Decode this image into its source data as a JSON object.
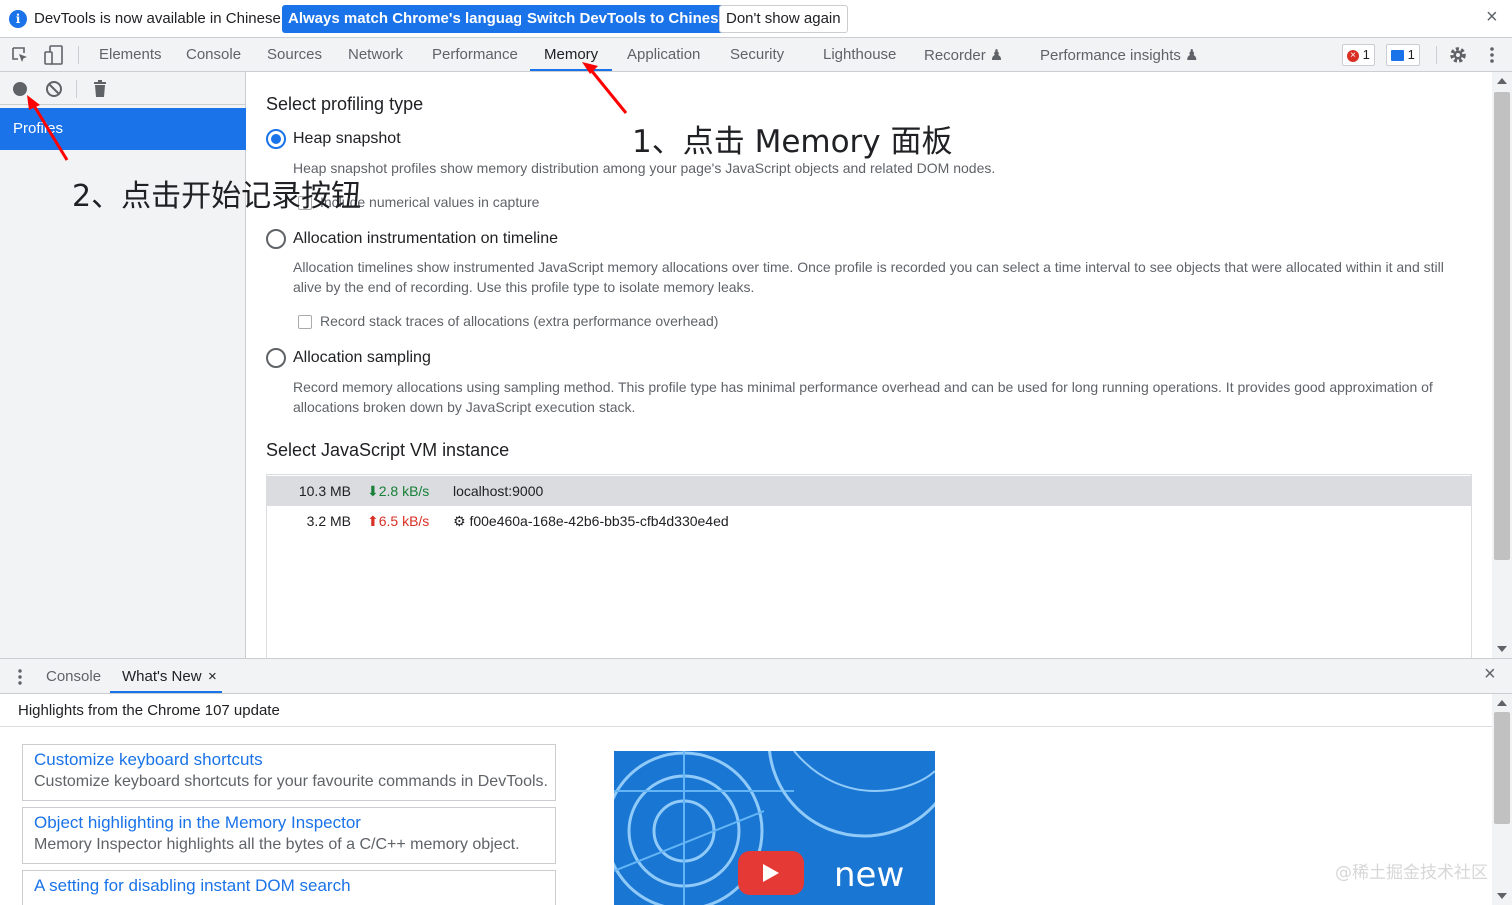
{
  "infobar": {
    "info_symbol": "i",
    "message": "DevTools is now available in Chinese!",
    "btn_match": "Always match Chrome's language",
    "btn_switch": "Switch DevTools to Chinese",
    "btn_dont_show": "Don't show again",
    "close": "×"
  },
  "tabs": [
    {
      "label": "Elements"
    },
    {
      "label": "Console"
    },
    {
      "label": "Sources"
    },
    {
      "label": "Network"
    },
    {
      "label": "Performance"
    },
    {
      "label": "Memory"
    },
    {
      "label": "Application"
    },
    {
      "label": "Security"
    },
    {
      "label": "Lighthouse"
    },
    {
      "label": "Recorder ♟"
    },
    {
      "label": "Performance insights ♟"
    }
  ],
  "active_tab": "Memory",
  "badges": {
    "errors": "1",
    "messages": "1"
  },
  "sidebar": {
    "item": "Profiles"
  },
  "profiling": {
    "title": "Select profiling type",
    "options": [
      {
        "label": "Heap snapshot",
        "selected": true,
        "desc": "Heap snapshot profiles show memory distribution among your page's JavaScript objects and related DOM nodes.",
        "checkbox": "Include numerical values in capture"
      },
      {
        "label": "Allocation instrumentation on timeline",
        "selected": false,
        "desc": "Allocation timelines show instrumented JavaScript memory allocations over time. Once profile is recorded you can select a time interval to see objects that were allocated within it and still alive by the end of recording. Use this profile type to isolate memory leaks.",
        "checkbox": "Record stack traces of allocations (extra performance overhead)"
      },
      {
        "label": "Allocation sampling",
        "selected": false,
        "desc": "Record memory allocations using sampling method. This profile type has minimal performance overhead and can be used for long running operations. It provides good approximation of allocations broken down by JavaScript execution stack."
      }
    ]
  },
  "vm": {
    "title": "Select JavaScript VM instance",
    "rows": [
      {
        "size": "10.3 MB",
        "rate": "⬇2.8 kB/s",
        "rate_color": "#188038",
        "url": "localhost:9000"
      },
      {
        "size": "3.2 MB",
        "rate": "⬆6.5 kB/s",
        "rate_color": "#d93025",
        "url": "⚙ f00e460a-168e-42b6-bb35-cfb4d330e4ed"
      }
    ]
  },
  "drawer": {
    "tabs": [
      "Console",
      "What's New"
    ],
    "tab_close": "×",
    "header": "Highlights from the Chrome 107 update",
    "cards": [
      {
        "title": "Customize keyboard shortcuts",
        "desc": "Customize keyboard shortcuts for your favourite commands in DevTools."
      },
      {
        "title": "Object highlighting in the Memory Inspector",
        "desc": "Memory Inspector highlights all the bytes of a C/C++ memory object."
      },
      {
        "title": "A setting for disabling instant DOM search",
        "desc": ""
      }
    ],
    "promo_text": "new"
  },
  "annotations": {
    "step1": "1、点击 Memory 面板",
    "step2": "2、点击开始记录按钮",
    "color": "#ff0000"
  },
  "watermark": "@稀土掘金技术社区"
}
